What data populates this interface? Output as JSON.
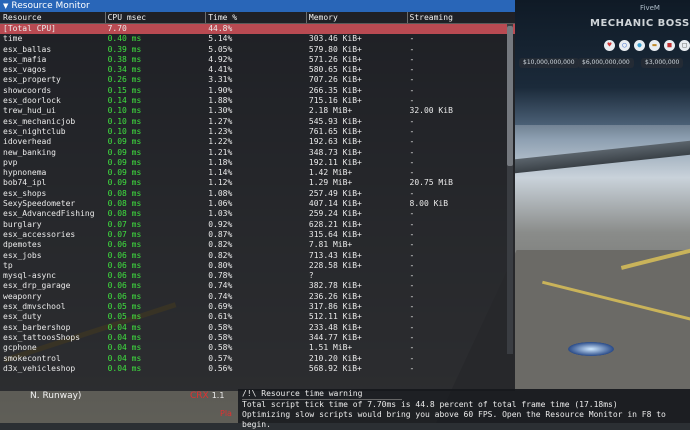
{
  "window": {
    "title": "Resource Monitor"
  },
  "columns": [
    "Resource",
    "CPU msec",
    "Time %",
    "Memory",
    "Streaming"
  ],
  "rows": [
    {
      "resource": "[Total CPU]",
      "cpu": "7.70",
      "time": "44.8%",
      "memory": "",
      "streaming": "",
      "selected": true
    },
    {
      "resource": "time",
      "cpu": "0.40 ms",
      "time": "5.14%",
      "memory": "303.46 KiB+",
      "streaming": "-"
    },
    {
      "resource": "esx_ballas",
      "cpu": "0.39 ms",
      "time": "5.05%",
      "memory": "579.80 KiB+",
      "streaming": "-"
    },
    {
      "resource": "esx_mafia",
      "cpu": "0.38 ms",
      "time": "4.92%",
      "memory": "571.26 KiB+",
      "streaming": "-"
    },
    {
      "resource": "esx_vagos",
      "cpu": "0.34 ms",
      "time": "4.41%",
      "memory": "580.65 KiB+",
      "streaming": "-"
    },
    {
      "resource": "esx_property",
      "cpu": "0.26 ms",
      "time": "3.31%",
      "memory": "707.26 KiB+",
      "streaming": "-"
    },
    {
      "resource": "showcoords",
      "cpu": "0.15 ms",
      "time": "1.90%",
      "memory": "266.35 KiB+",
      "streaming": "-"
    },
    {
      "resource": "esx_doorlock",
      "cpu": "0.14 ms",
      "time": "1.88%",
      "memory": "715.16 KiB+",
      "streaming": "-"
    },
    {
      "resource": "trew_hud_ui",
      "cpu": "0.10 ms",
      "time": "1.30%",
      "memory": "2.18 MiB+",
      "streaming": "32.00 KiB"
    },
    {
      "resource": "esx_mechanicjob",
      "cpu": "0.10 ms",
      "time": "1.27%",
      "memory": "545.93 KiB+",
      "streaming": "-"
    },
    {
      "resource": "esx_nightclub",
      "cpu": "0.10 ms",
      "time": "1.23%",
      "memory": "761.65 KiB+",
      "streaming": "-"
    },
    {
      "resource": "idoverhead",
      "cpu": "0.09 ms",
      "time": "1.22%",
      "memory": "192.63 KiB+",
      "streaming": "-"
    },
    {
      "resource": "new_banking",
      "cpu": "0.09 ms",
      "time": "1.21%",
      "memory": "348.73 KiB+",
      "streaming": "-"
    },
    {
      "resource": "pvp",
      "cpu": "0.09 ms",
      "time": "1.18%",
      "memory": "192.11 KiB+",
      "streaming": "-"
    },
    {
      "resource": "hypnonema",
      "cpu": "0.09 ms",
      "time": "1.14%",
      "memory": "1.42 MiB+",
      "streaming": "-"
    },
    {
      "resource": "bob74_ipl",
      "cpu": "0.09 ms",
      "time": "1.12%",
      "memory": "1.29 MiB+",
      "streaming": "20.75 MiB"
    },
    {
      "resource": "esx_shops",
      "cpu": "0.08 ms",
      "time": "1.08%",
      "memory": "257.49 KiB+",
      "streaming": "-"
    },
    {
      "resource": "SexySpeedometer",
      "cpu": "0.08 ms",
      "time": "1.06%",
      "memory": "407.14 KiB+",
      "streaming": "8.00 KiB"
    },
    {
      "resource": "esx_AdvancedFishing",
      "cpu": "0.08 ms",
      "time": "1.03%",
      "memory": "259.24 KiB+",
      "streaming": "-"
    },
    {
      "resource": "burglary",
      "cpu": "0.07 ms",
      "time": "0.92%",
      "memory": "628.21 KiB+",
      "streaming": "-"
    },
    {
      "resource": "esx_accessories",
      "cpu": "0.07 ms",
      "time": "0.87%",
      "memory": "315.64 KiB+",
      "streaming": "-"
    },
    {
      "resource": "dpemotes",
      "cpu": "0.06 ms",
      "time": "0.82%",
      "memory": "7.81 MiB+",
      "streaming": "-"
    },
    {
      "resource": "esx_jobs",
      "cpu": "0.06 ms",
      "time": "0.82%",
      "memory": "713.43 KiB+",
      "streaming": "-"
    },
    {
      "resource": "tp",
      "cpu": "0.06 ms",
      "time": "0.80%",
      "memory": "228.58 KiB+",
      "streaming": "-"
    },
    {
      "resource": "mysql-async",
      "cpu": "0.06 ms",
      "time": "0.78%",
      "memory": "?",
      "streaming": "-"
    },
    {
      "resource": "esx_drp_garage",
      "cpu": "0.06 ms",
      "time": "0.74%",
      "memory": "382.78 KiB+",
      "streaming": "-"
    },
    {
      "resource": "weaponry",
      "cpu": "0.06 ms",
      "time": "0.74%",
      "memory": "236.26 KiB+",
      "streaming": "-"
    },
    {
      "resource": "esx_dmvschool",
      "cpu": "0.05 ms",
      "time": "0.69%",
      "memory": "317.86 KiB+",
      "streaming": "-"
    },
    {
      "resource": "esx_duty",
      "cpu": "0.05 ms",
      "time": "0.61%",
      "memory": "512.11 KiB+",
      "streaming": "-"
    },
    {
      "resource": "esx_barbershop",
      "cpu": "0.04 ms",
      "time": "0.58%",
      "memory": "233.48 KiB+",
      "streaming": "-"
    },
    {
      "resource": "esx_tattoosShops",
      "cpu": "0.04 ms",
      "time": "0.58%",
      "memory": "344.77 KiB+",
      "streaming": "-"
    },
    {
      "resource": "gcphone",
      "cpu": "0.04 ms",
      "time": "0.58%",
      "memory": "1.51 MiB+",
      "streaming": "-"
    },
    {
      "resource": "smokecontrol",
      "cpu": "0.04 ms",
      "time": "0.57%",
      "memory": "210.20 KiB+",
      "streaming": "-"
    },
    {
      "resource": "d3x_vehicleshop",
      "cpu": "0.04 ms",
      "time": "0.56%",
      "memory": "568.92 KiB+",
      "streaming": "-"
    }
  ],
  "hud": {
    "server_title": "MECHANIC BOSS",
    "player_name": "FiveM",
    "money": [
      "$10,000,000,000",
      "$6,000,000,000",
      "$3,000,000"
    ],
    "icons": [
      "heart-icon",
      "shield-icon",
      "drop-icon",
      "burger-icon",
      "lock-icon",
      "id-icon"
    ]
  },
  "location": {
    "street": "N. Runway)",
    "compass_code": "CRX",
    "compass_value": "1.1",
    "partial_label": "Pla"
  },
  "warning": {
    "title": "/!\\ Resource time warning",
    "line1": "Total script tick time of 7.70ms is 44.8 percent of total frame time (17.18ms)",
    "line2": "Optimizing slow scripts would bring you above 60 FPS. Open the Resource Monitor in F8 to begin."
  },
  "colors": {
    "title_bar": "#2966b8",
    "selected_row": "#b94a52",
    "cpu_text": "#3fe03f",
    "warning_text": "#e23030"
  }
}
